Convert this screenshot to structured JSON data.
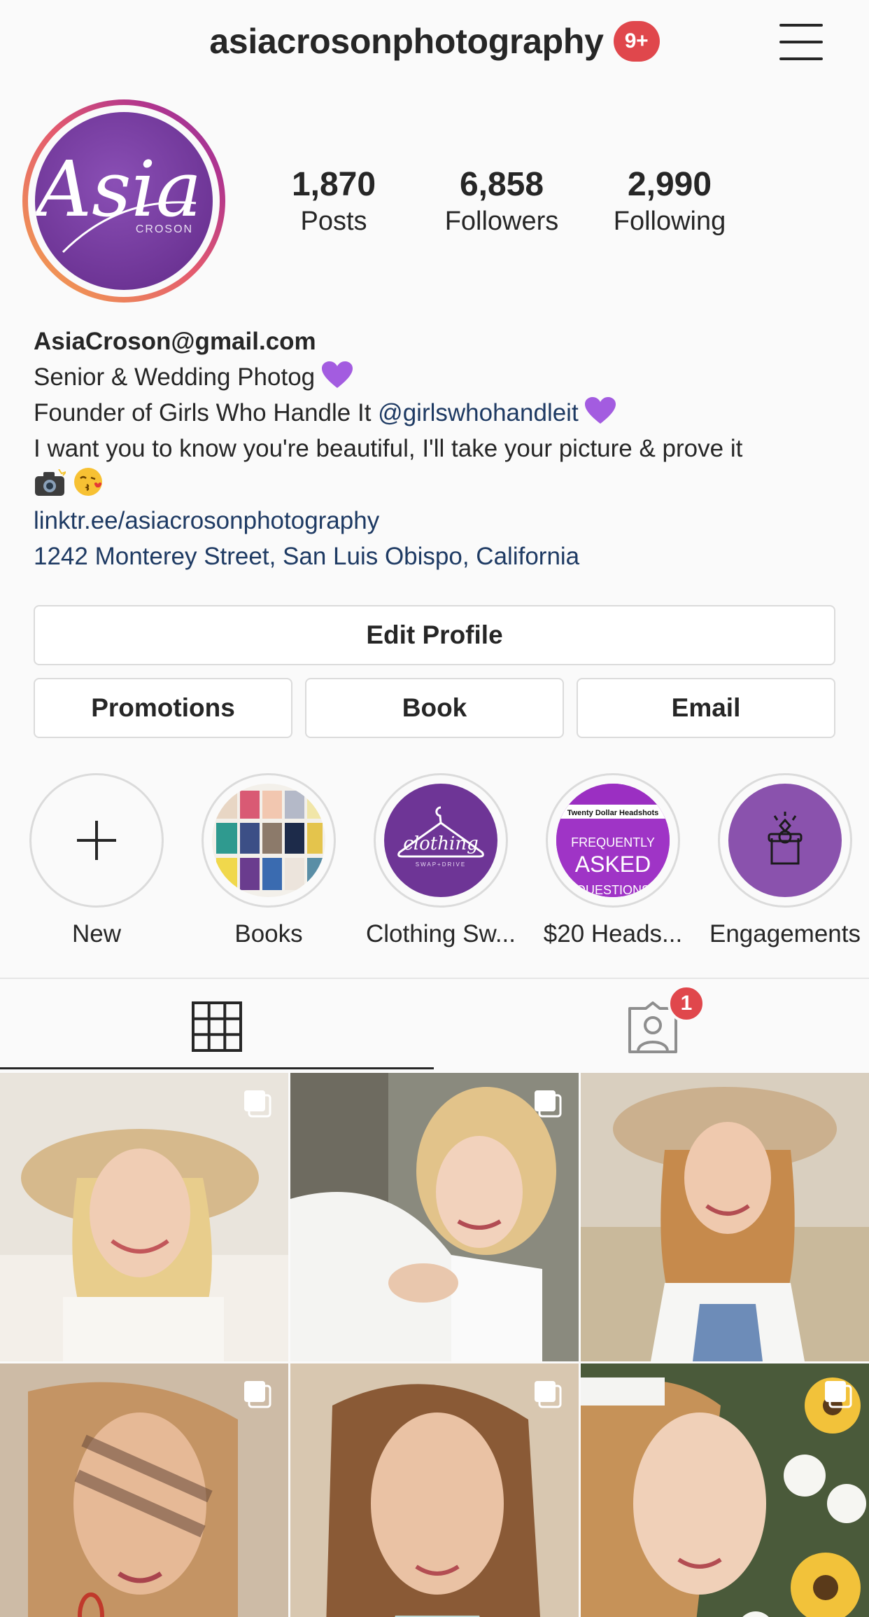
{
  "header": {
    "username": "asiacrosonphotography",
    "notification_badge": "9+",
    "menu_icon": "hamburger-menu-icon"
  },
  "profile": {
    "avatar_text_main": "Asia",
    "avatar_text_sub": "CROSON",
    "stats": [
      {
        "value": "1,870",
        "label": "Posts"
      },
      {
        "value": "6,858",
        "label": "Followers"
      },
      {
        "value": "2,990",
        "label": "Following"
      }
    ],
    "bio": {
      "name": "AsiaCroson@gmail.com",
      "line1": "Senior & Wedding Photog",
      "line2_prefix": "Founder of Girls Who Handle It",
      "line2_mention": "@girlswhohandleit",
      "line3": "I want you to know you're beautiful, I'll take your picture & prove it",
      "website": "linktr.ee/asiacrosonphotography",
      "address": "1242 Monterey Street, San Luis Obispo, California"
    }
  },
  "buttons": {
    "edit_profile": "Edit Profile",
    "promotions": "Promotions",
    "book": "Book",
    "email": "Email"
  },
  "highlights": [
    {
      "label": "New",
      "icon": "plus-icon"
    },
    {
      "label": "Books"
    },
    {
      "label": "Clothing Sw...",
      "image_text": "clothing",
      "image_subtext": "SWAP+DRIVE"
    },
    {
      "label": "$20 Heads...",
      "image_title": "Twenty Dollar Headshots",
      "image_line1": "FREQUENTLY",
      "image_line2": "ASKED",
      "image_line3": "QUESTIONS"
    },
    {
      "label": "Engagements",
      "icon": "ring-box-icon"
    }
  ],
  "tabs": {
    "grid_icon": "grid-icon",
    "tagged_icon": "tagged-person-icon",
    "tagged_badge": "1"
  },
  "colors": {
    "accent_purple": "#6e3596",
    "badge_red": "#e0474c",
    "link_blue": "#1e3a63"
  }
}
